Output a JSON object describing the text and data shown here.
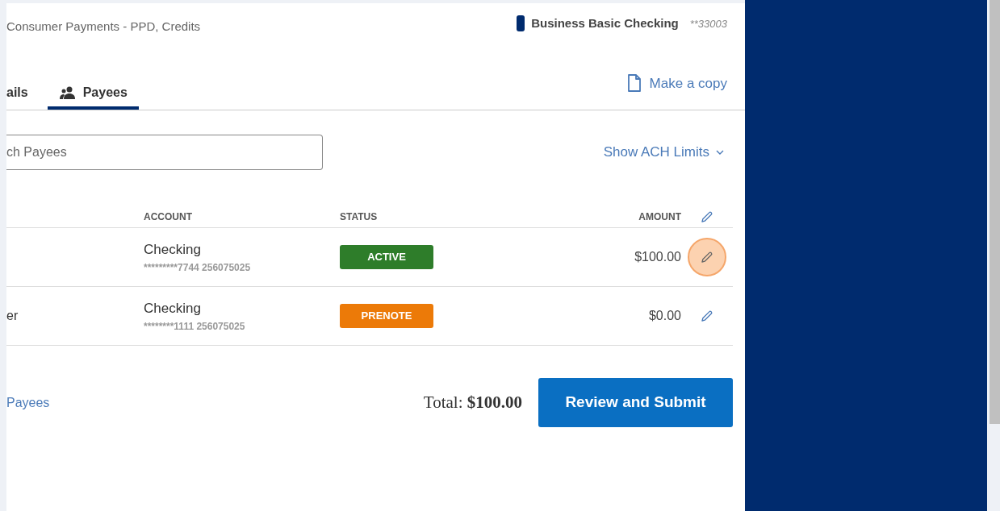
{
  "header": {
    "subtitle": "Consumer Payments - PPD, Credits",
    "account_name": "Business Basic Checking",
    "account_number": "**33003"
  },
  "tabs": [
    {
      "label": "ails",
      "selected": false,
      "icon": false
    },
    {
      "label": "Payees",
      "selected": true,
      "icon": true
    }
  ],
  "make_copy": "Make a copy",
  "search": {
    "placeholder": "ch Payees"
  },
  "ach_limits": "Show ACH Limits",
  "table": {
    "columns": [
      "ACCOUNT",
      "STATUS",
      "AMOUNT"
    ],
    "rows": [
      {
        "name": "",
        "account_type": "Checking",
        "account_number": "*********7744 256075025",
        "status": "ACTIVE",
        "color": "#2e7d2a",
        "amount": "$100.00",
        "highlighted": true
      },
      {
        "name": "er",
        "account_type": "Checking",
        "account_number": "********1111 256075025",
        "status": "PRENOTE",
        "color": "#ec7a08",
        "amount": "$0.00",
        "highlighted": false
      }
    ]
  },
  "footer": {
    "link": "Payees",
    "total_label": "Total:",
    "total_value": "$100.00",
    "submit": "Review and Submit"
  }
}
